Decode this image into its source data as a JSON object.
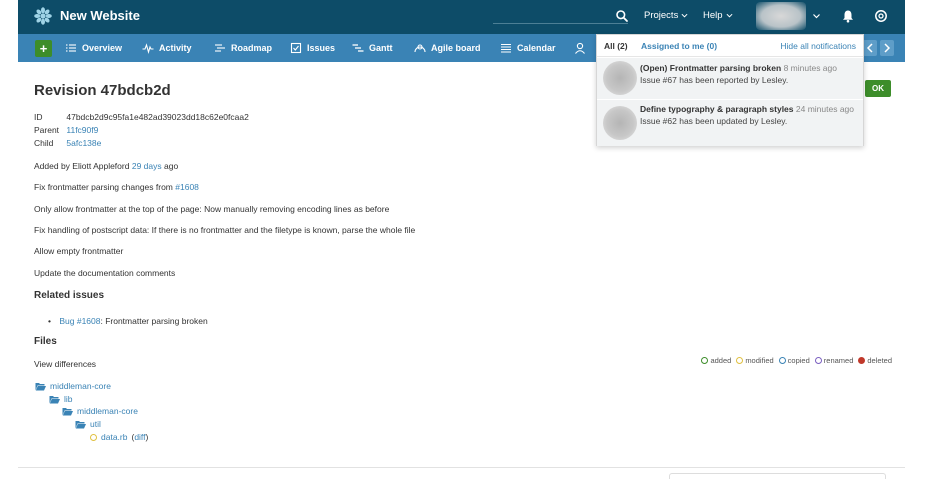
{
  "header": {
    "site_title": "New Website",
    "menus": [
      {
        "label": "Projects"
      },
      {
        "label": "Help"
      }
    ]
  },
  "nav": {
    "items": [
      {
        "label": "Overview",
        "icon": "list-icon"
      },
      {
        "label": "Activity",
        "icon": "activity-icon"
      },
      {
        "label": "Roadmap",
        "icon": "roadmap-icon"
      },
      {
        "label": "Issues",
        "icon": "issues-icon"
      },
      {
        "label": "Gantt",
        "icon": "gantt-icon"
      },
      {
        "label": "Agile board",
        "icon": "agile-icon"
      },
      {
        "label": "Calendar",
        "icon": "calendar-icon"
      }
    ],
    "plus_label": "+"
  },
  "revision": {
    "title": "Revision 47bdcb2d",
    "id_label": "ID",
    "id_value": "47bdcb2d9c95fa1e482ad39023dd18c62e0fcaa2",
    "parent_label": "Parent",
    "parent_value": "11fc90f9",
    "child_label": "Child",
    "child_value": "5afc138e",
    "added_by_prefix": "Added by Eliott Appleford",
    "added_by_time": "29 days",
    "added_by_suffix": "ago",
    "message_line1_prefix": "Fix frontmatter parsing changes from",
    "message_line1_link": "#1608",
    "message_lines": [
      "Only allow frontmatter at the top of the page: Now manually removing encoding lines as before",
      "Fix handling of postscript data: If there is no frontmatter and the filetype is known, parse the whole file",
      "Allow empty frontmatter",
      "Update the documentation comments"
    ]
  },
  "related": {
    "heading": "Related issues",
    "items": [
      {
        "link": "Bug #1608",
        "text": ": Frontmatter parsing broken"
      }
    ]
  },
  "files": {
    "heading": "Files",
    "view_diff": "View differences",
    "legend": [
      {
        "label": "added",
        "color": "#3d8d2a"
      },
      {
        "label": "modified",
        "color": "#e0c040"
      },
      {
        "label": "copied",
        "color": "#3a83b5"
      },
      {
        "label": "renamed",
        "color": "#7a5fc0"
      },
      {
        "label": "deleted",
        "color": "#c0392b"
      }
    ],
    "tree": [
      {
        "name": "middleman-core",
        "type": "folder"
      },
      {
        "name": "lib",
        "type": "folder"
      },
      {
        "name": "middleman-core",
        "type": "folder"
      },
      {
        "name": "util",
        "type": "folder"
      },
      {
        "name": "data.rb",
        "type": "file",
        "diff_label": "diff"
      }
    ]
  },
  "ok_button": "OK",
  "notifications": {
    "tab_all": "All (2)",
    "tab_assigned": "Assigned to me (0)",
    "hide_all": "Hide all notifications",
    "items": [
      {
        "title": "(Open) Frontmatter parsing broken",
        "time": "8 minutes ago",
        "body": "Issue #67 has been reported by Lesley."
      },
      {
        "title": "Define typography & paragraph styles",
        "time": "24 minutes ago",
        "body": "Issue #62 has been updated by Lesley."
      }
    ]
  },
  "colors": {
    "header_bg": "#0d4c68",
    "nav_bg": "#3a83b5",
    "accent_green": "#3d8d2a",
    "link": "#3a83b5"
  }
}
